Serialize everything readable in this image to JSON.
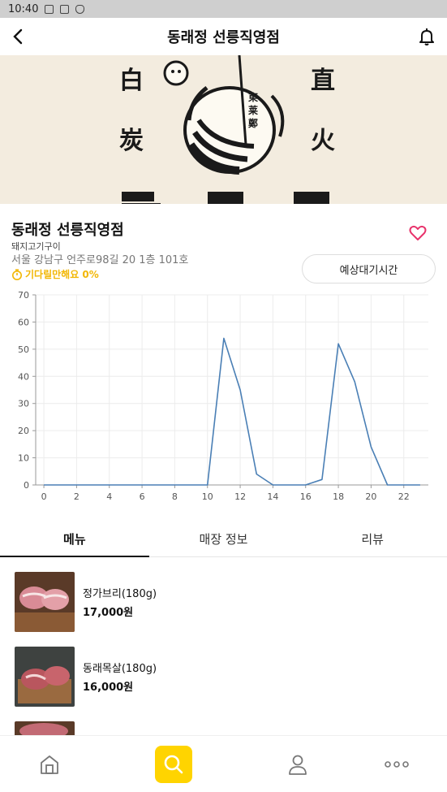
{
  "status_bar": {
    "time": "10:40"
  },
  "header": {
    "title": "동래정 선릉직영점"
  },
  "hero": {
    "chars": [
      "白",
      "炭",
      "直",
      "火"
    ],
    "seal_text": "東莱鄭"
  },
  "store": {
    "name": "동래정 선릉직영점",
    "category": "돼지고기구이",
    "address": "서울 강남구 언주로98길 20 1층 101호",
    "wait_status": "기다릴만해요 0%",
    "wait_button": "예상대기시간"
  },
  "colors": {
    "accent": "#ffd400",
    "warning_text": "#f2b705",
    "heart": "#e8326b",
    "line": "#4a7fb5"
  },
  "chart_data": {
    "type": "line",
    "x": [
      0,
      1,
      2,
      3,
      4,
      5,
      6,
      7,
      8,
      9,
      10,
      11,
      12,
      13,
      14,
      15,
      16,
      17,
      18,
      19,
      20,
      21,
      22,
      23
    ],
    "series": [
      {
        "values": [
          0,
          0,
          0,
          0,
          0,
          0,
          0,
          0,
          0,
          0,
          0,
          54,
          35,
          4,
          0,
          0,
          0,
          2,
          52,
          38,
          14,
          0,
          0,
          0
        ]
      }
    ],
    "xticks": [
      0,
      2,
      4,
      6,
      8,
      10,
      12,
      14,
      16,
      18,
      20,
      22
    ],
    "yticks": [
      0,
      10,
      20,
      30,
      40,
      50,
      60,
      70
    ],
    "xlim": [
      -0.5,
      23.5
    ],
    "ylim": [
      0,
      70
    ],
    "grid": true
  },
  "tabs": [
    {
      "label": "메뉴",
      "active": true
    },
    {
      "label": "매장 정보",
      "active": false
    },
    {
      "label": "리뷰",
      "active": false
    }
  ],
  "menu": [
    {
      "name": "정가브리(180g)",
      "price": "17,000원"
    },
    {
      "name": "동래목살(180g)",
      "price": "16,000원"
    }
  ],
  "nav": [
    "home-icon",
    "search-icon",
    "user-icon",
    "more-icon"
  ]
}
